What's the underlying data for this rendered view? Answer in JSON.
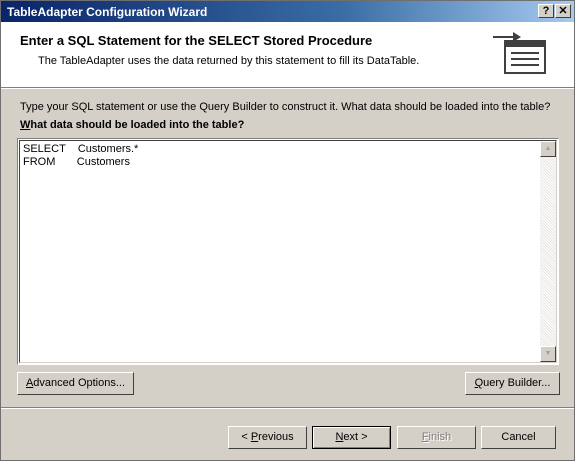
{
  "window": {
    "title": "TableAdapter Configuration Wizard",
    "help_glyph": "?",
    "close_glyph": "✕"
  },
  "header": {
    "title": "Enter a SQL Statement for the SELECT Stored Procedure",
    "subtitle": "The TableAdapter uses the data returned by this statement to fill its DataTable.",
    "icon": "sql-statement-wizard-icon"
  },
  "body": {
    "instruction": "Type your SQL statement or use the Query Builder to construct it. What data should be loaded into the table?",
    "question_mnemonic": "W",
    "question_rest": "hat data should be loaded into the table?",
    "sql_text": "SELECT    Customers.*\nFROM       Customers"
  },
  "buttons": {
    "advanced_mnemonic": "A",
    "advanced_rest": "dvanced Options...",
    "query_builder_mnemonic": "Q",
    "query_builder_rest": "uery Builder...",
    "previous_prefix": "< ",
    "previous_mnemonic": "P",
    "previous_rest": "revious",
    "next_mnemonic": "N",
    "next_rest": "ext >",
    "finish_mnemonic": "F",
    "finish_rest": "inish",
    "cancel": "Cancel"
  },
  "colors": {
    "titlebar_start": "#0a246a",
    "titlebar_end": "#a6caf0",
    "face": "#d4d0c8"
  }
}
